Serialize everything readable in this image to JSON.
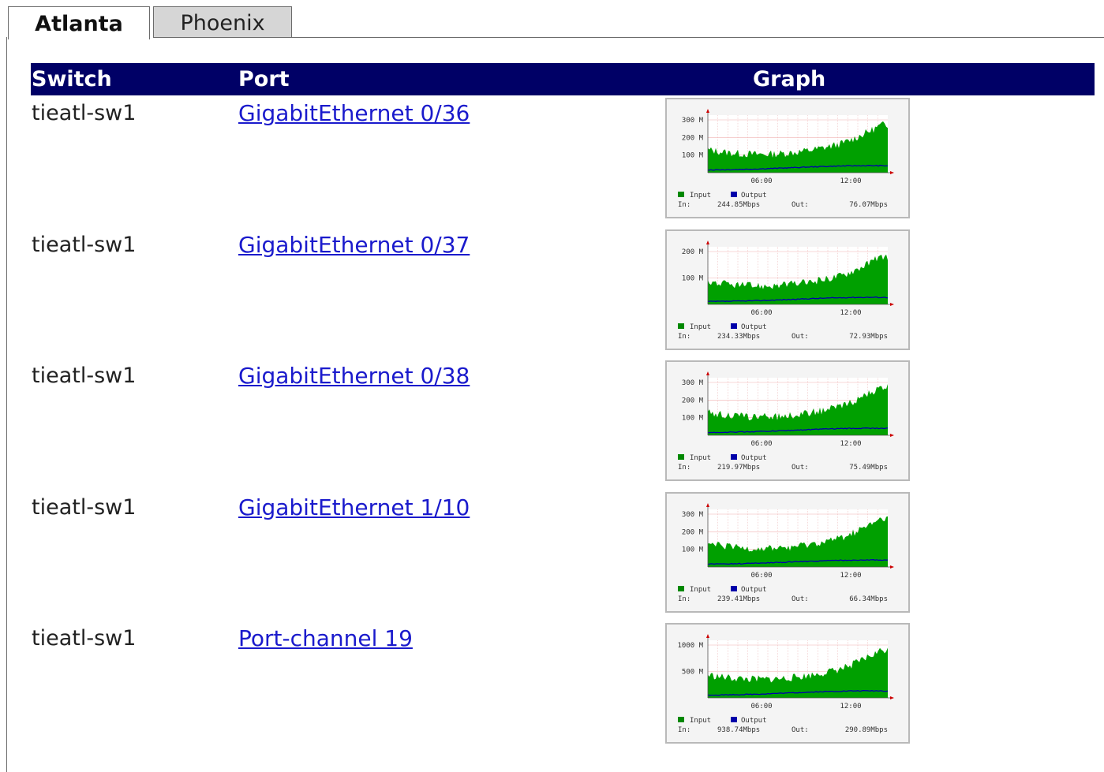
{
  "tabs": [
    {
      "label": "Atlanta",
      "active": true
    },
    {
      "label": "Phoenix",
      "active": false
    }
  ],
  "table": {
    "headers": {
      "switch": "Switch",
      "port": "Port",
      "graph": "Graph"
    },
    "rows": [
      {
        "switch": "tieatl-sw1",
        "port": "GigabitEthernet 0/36",
        "graph": {
          "y_ticks": [
            "300 M",
            "200 M",
            "100 M"
          ],
          "x_ticks": [
            "06:00",
            "12:00"
          ],
          "legend_input": "Input",
          "legend_output": "Output",
          "in_label": "In:",
          "in_value": "244.85Mbps",
          "out_label": "Out:",
          "out_value": "76.07Mbps"
        }
      },
      {
        "switch": "tieatl-sw1",
        "port": "GigabitEthernet 0/37",
        "graph": {
          "y_ticks": [
            "200 M",
            "100 M"
          ],
          "x_ticks": [
            "06:00",
            "12:00"
          ],
          "legend_input": "Input",
          "legend_output": "Output",
          "in_label": "In:",
          "in_value": "234.33Mbps",
          "out_label": "Out:",
          "out_value": "72.93Mbps"
        }
      },
      {
        "switch": "tieatl-sw1",
        "port": "GigabitEthernet 0/38",
        "graph": {
          "y_ticks": [
            "300 M",
            "200 M",
            "100 M"
          ],
          "x_ticks": [
            "06:00",
            "12:00"
          ],
          "legend_input": "Input",
          "legend_output": "Output",
          "in_label": "In:",
          "in_value": "219.97Mbps",
          "out_label": "Out:",
          "out_value": "75.49Mbps"
        }
      },
      {
        "switch": "tieatl-sw1",
        "port": "GigabitEthernet 1/10",
        "graph": {
          "y_ticks": [
            "300 M",
            "200 M",
            "100 M"
          ],
          "x_ticks": [
            "06:00",
            "12:00"
          ],
          "legend_input": "Input",
          "legend_output": "Output",
          "in_label": "In:",
          "in_value": "239.41Mbps",
          "out_label": "Out:",
          "out_value": "66.34Mbps"
        }
      },
      {
        "switch": "tieatl-sw1",
        "port": "Port-channel 19",
        "graph": {
          "y_ticks": [
            "1000 M",
            "500 M"
          ],
          "x_ticks": [
            "06:00",
            "12:00"
          ],
          "legend_input": "Input",
          "legend_output": "Output",
          "in_label": "In:",
          "in_value": "938.74Mbps",
          "out_label": "Out:",
          "out_value": "290.89Mbps"
        }
      }
    ]
  },
  "colors": {
    "header_bg": "#000066",
    "input_series": "#00a000",
    "output_series": "#0000aa",
    "link": "#1a1acc"
  }
}
